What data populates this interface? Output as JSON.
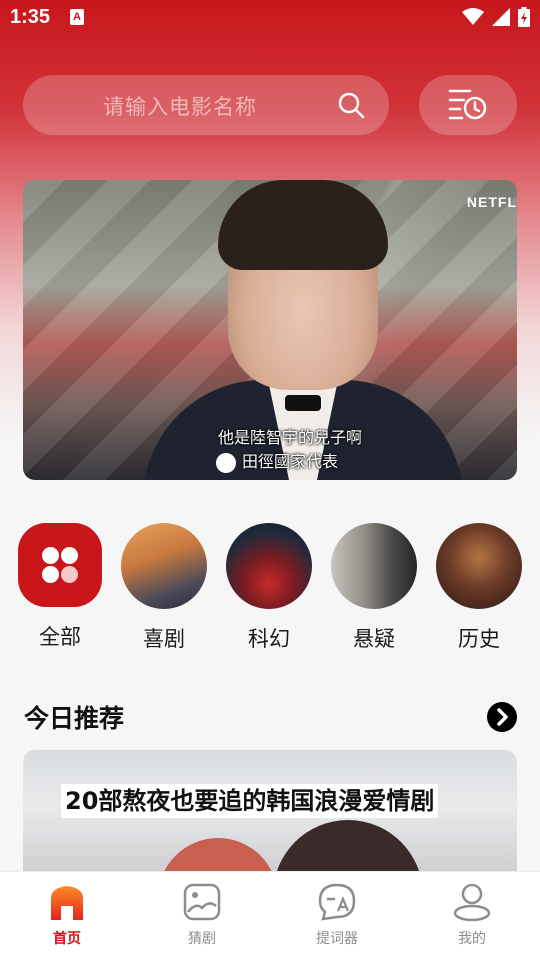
{
  "status_bar": {
    "time": "1:35",
    "notif_letter": "A"
  },
  "search": {
    "placeholder": "请输入电影名称"
  },
  "banner": {
    "watermark": "NETFL",
    "subtitle_line1": "他是陸智宇的兒子啊",
    "subtitle_line2": "田徑國家代表"
  },
  "categories": [
    {
      "label": "全部"
    },
    {
      "label": "喜剧"
    },
    {
      "label": "科幻"
    },
    {
      "label": "悬疑"
    },
    {
      "label": "历史"
    }
  ],
  "recommend": {
    "title": "今日推荐",
    "card_text": "20部熬夜也要追的韩国浪漫爱情剧"
  },
  "nav": {
    "home": "首页",
    "guess": "猜剧",
    "prompter": "提词器",
    "mine": "我的"
  },
  "colors": {
    "accent": "#c8161b"
  }
}
